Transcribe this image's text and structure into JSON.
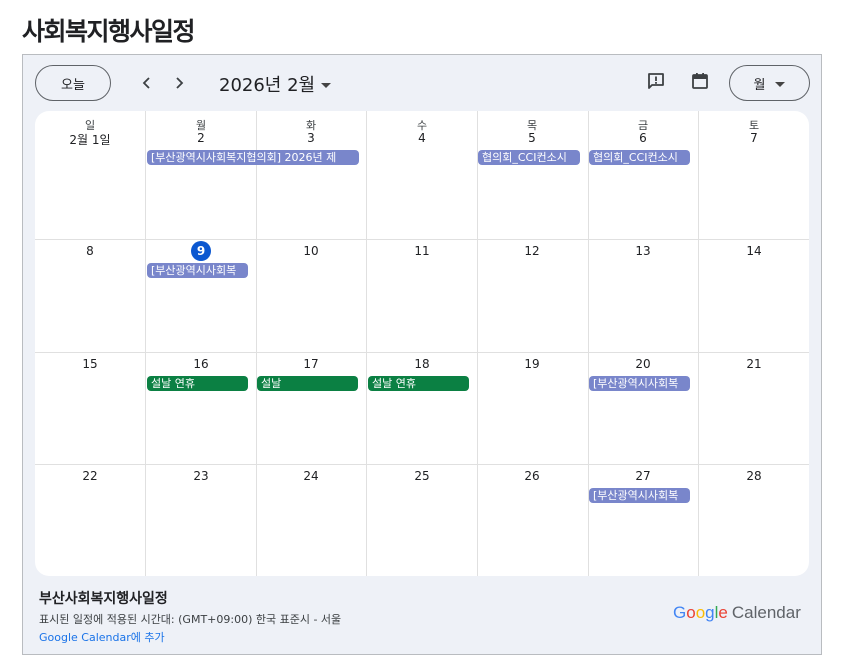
{
  "page": {
    "title": "사회복지행사일정"
  },
  "toolbar": {
    "today_label": "오늘",
    "prev_icon": "chevron-left-icon",
    "next_icon": "chevron-right-icon",
    "month_label": "2026년 2월",
    "feedback_icon": "feedback-icon",
    "calendar_icon": "calendar-icon",
    "view_label": "월"
  },
  "weekdays": [
    "일",
    "월",
    "화",
    "수",
    "목",
    "금",
    "토"
  ],
  "weeks": [
    [
      "2월 1일",
      "2",
      "3",
      "4",
      "5",
      "6",
      "7"
    ],
    [
      "8",
      "9",
      "10",
      "11",
      "12",
      "13",
      "14"
    ],
    [
      "15",
      "16",
      "17",
      "18",
      "19",
      "20",
      "21"
    ],
    [
      "22",
      "23",
      "24",
      "25",
      "26",
      "27",
      "28"
    ]
  ],
  "today": "9",
  "events": [
    {
      "title": "[부산광역시사회복지협의회] 2026년 제",
      "color": "#7986cb"
    },
    {
      "title": "협의회_CCI컨소시",
      "color": "#7986cb"
    },
    {
      "title": "협의회_CCI컨소시",
      "color": "#7986cb"
    },
    {
      "title": "[부산광역시사회복",
      "color": "#7986cb"
    },
    {
      "title": "설날 연휴",
      "color": "#0b8043"
    },
    {
      "title": "설날",
      "color": "#0b8043"
    },
    {
      "title": "설날 연휴",
      "color": "#0b8043"
    },
    {
      "title": "[부산광역시사회복",
      "color": "#7986cb"
    },
    {
      "title": "[부산광역시사회복",
      "color": "#7986cb"
    }
  ],
  "footer": {
    "calendar_name": "부산사회복지행사일정",
    "timezone": "표시된 일정에 적용된 시간대: (GMT+09:00) 한국 표준시 - 서울",
    "add_link": "Google Calendar에 추가",
    "brand_google": "Google",
    "brand_calendar": "Calendar"
  },
  "colors": {
    "today": "#0b57d0",
    "event_purple": "#7986cb",
    "event_green": "#0b8043",
    "link": "#1a73e8"
  }
}
